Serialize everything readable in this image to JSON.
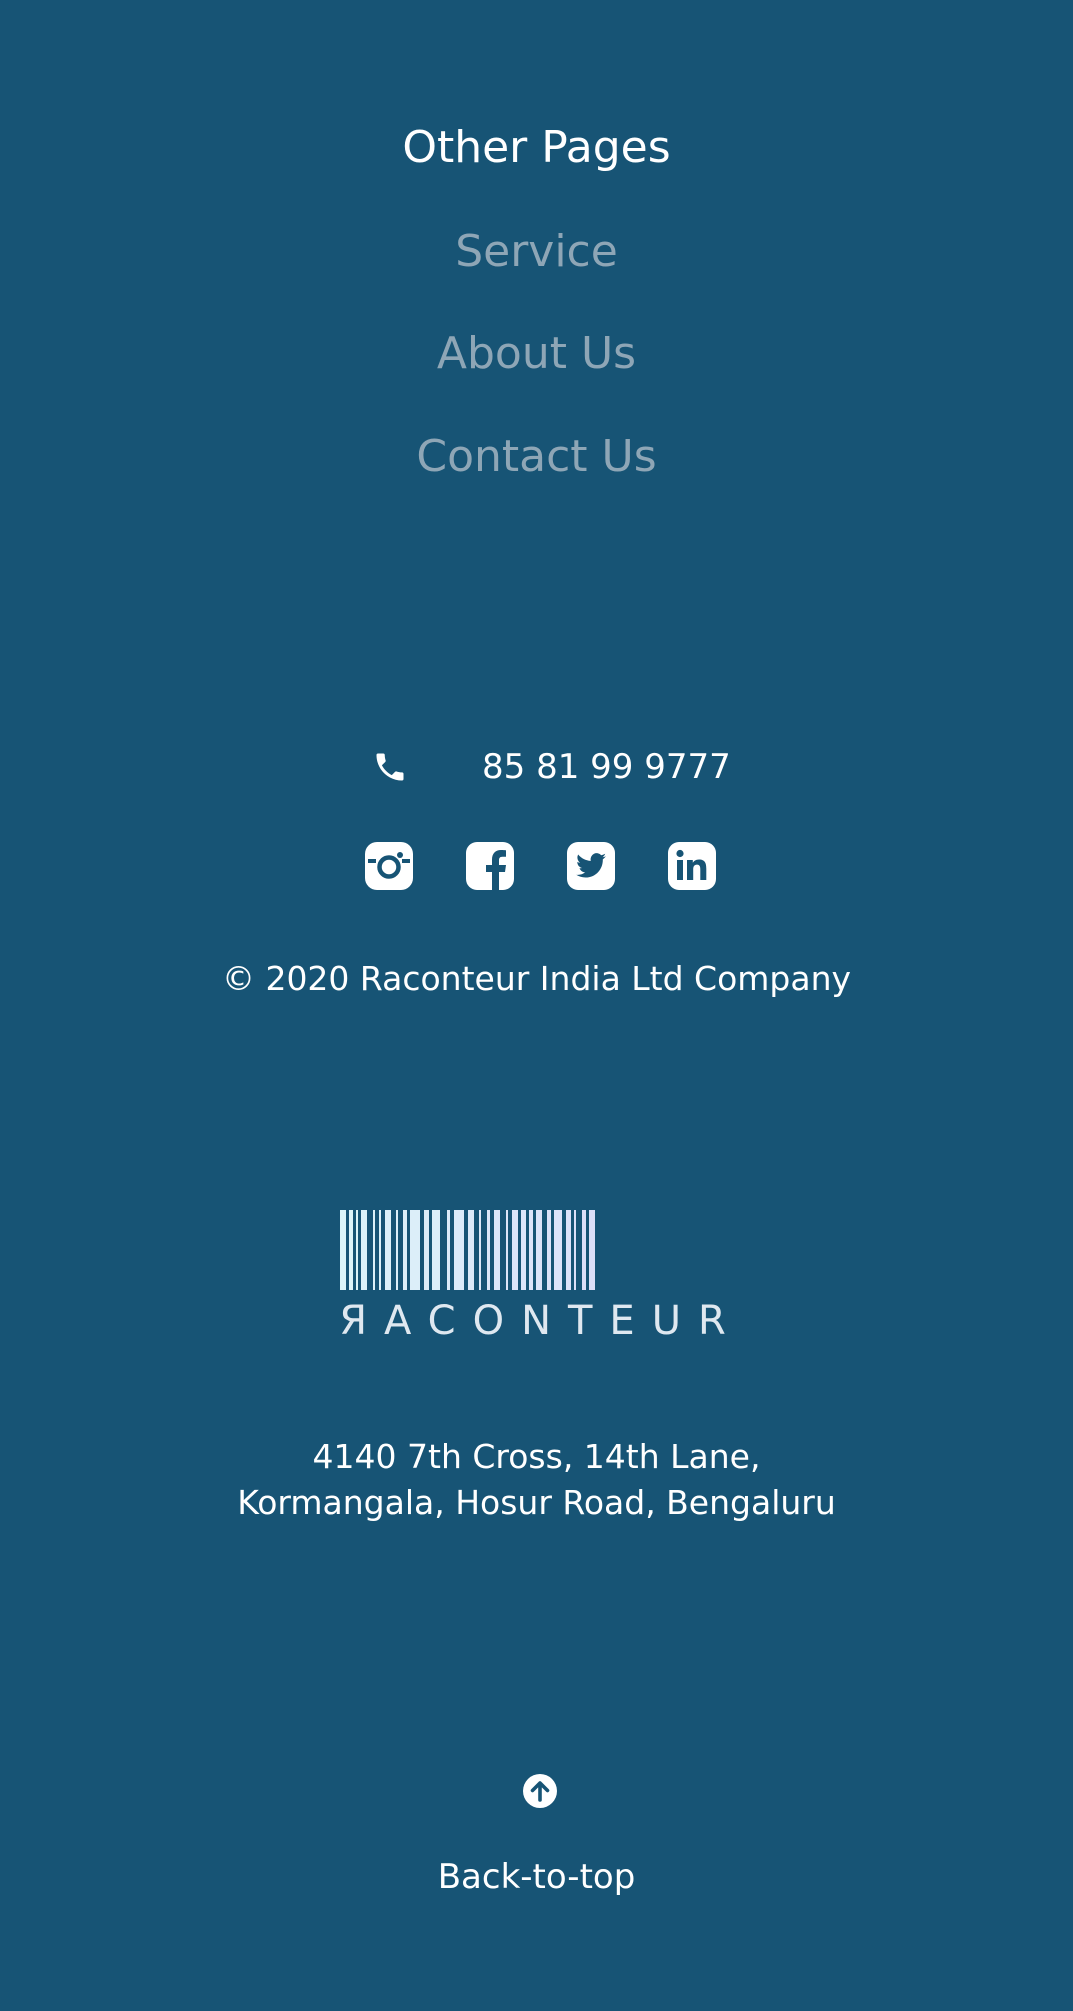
{
  "footer": {
    "other_pages": {
      "heading": "Other Pages",
      "links": [
        {
          "label": "Service"
        },
        {
          "label": "About Us"
        },
        {
          "label": "Contact Us"
        }
      ]
    },
    "contact": {
      "phone_icon": "phone-icon",
      "phone": "85 81 99 9777"
    },
    "social": [
      {
        "icon": "instagram-icon",
        "label": "Instagram"
      },
      {
        "icon": "facebook-icon",
        "label": "Facebook"
      },
      {
        "icon": "twitter-icon",
        "label": "Twitter"
      },
      {
        "icon": "linkedin-icon",
        "label": "LinkedIn"
      }
    ],
    "copyright": "© 2020 Raconteur India Ltd Company",
    "logo": {
      "wordmark": "ЯACONTEUR"
    },
    "address": {
      "line1": "4140 7th Cross, 14th Lane,",
      "line2": "Kormangala, Hosur Road, Bengaluru"
    },
    "back_to_top": {
      "icon": "arrow-up-circle-icon",
      "label": "Back-to-top"
    }
  },
  "colors": {
    "background": "#175475",
    "text": "#ffffff",
    "muted_link": "#8ea6b6"
  }
}
